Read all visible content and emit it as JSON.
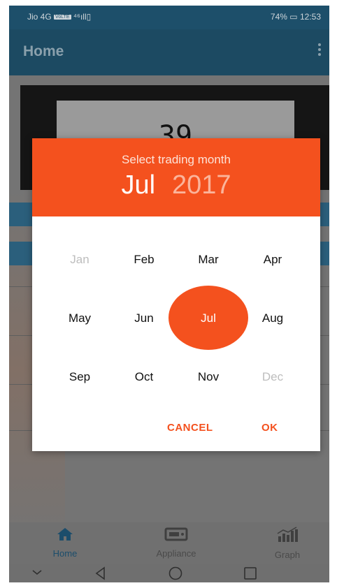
{
  "status_bar": {
    "carrier": "Jio 4G",
    "volte": "VoLTE",
    "signal": "⁴⁶ᵢₗ",
    "battery": "74%",
    "time": "12:53"
  },
  "app_bar": {
    "title": "Home"
  },
  "display": {
    "reading": "39"
  },
  "dialog": {
    "title": "Select trading month",
    "selected_month": "Jul",
    "selected_year": "2017",
    "months": [
      {
        "label": "Jan",
        "state": "disabled"
      },
      {
        "label": "Feb",
        "state": "enabled"
      },
      {
        "label": "Mar",
        "state": "enabled"
      },
      {
        "label": "Apr",
        "state": "enabled"
      },
      {
        "label": "May",
        "state": "enabled"
      },
      {
        "label": "Jun",
        "state": "enabled"
      },
      {
        "label": "Jul",
        "state": "selected"
      },
      {
        "label": "Aug",
        "state": "enabled"
      },
      {
        "label": "Sep",
        "state": "enabled"
      },
      {
        "label": "Oct",
        "state": "enabled"
      },
      {
        "label": "Nov",
        "state": "enabled"
      },
      {
        "label": "Dec",
        "state": "disabled"
      }
    ],
    "cancel_label": "CANCEL",
    "ok_label": "OK"
  },
  "bottom_nav": {
    "items": [
      {
        "label": "Home",
        "icon": "home-icon"
      },
      {
        "label": "Appliance",
        "icon": "appliance-icon"
      },
      {
        "label": "Graph",
        "icon": "graph-icon"
      }
    ]
  },
  "colors": {
    "accent": "#f4511e",
    "app_bar": "#1c4a62",
    "scrim": "#747474"
  }
}
